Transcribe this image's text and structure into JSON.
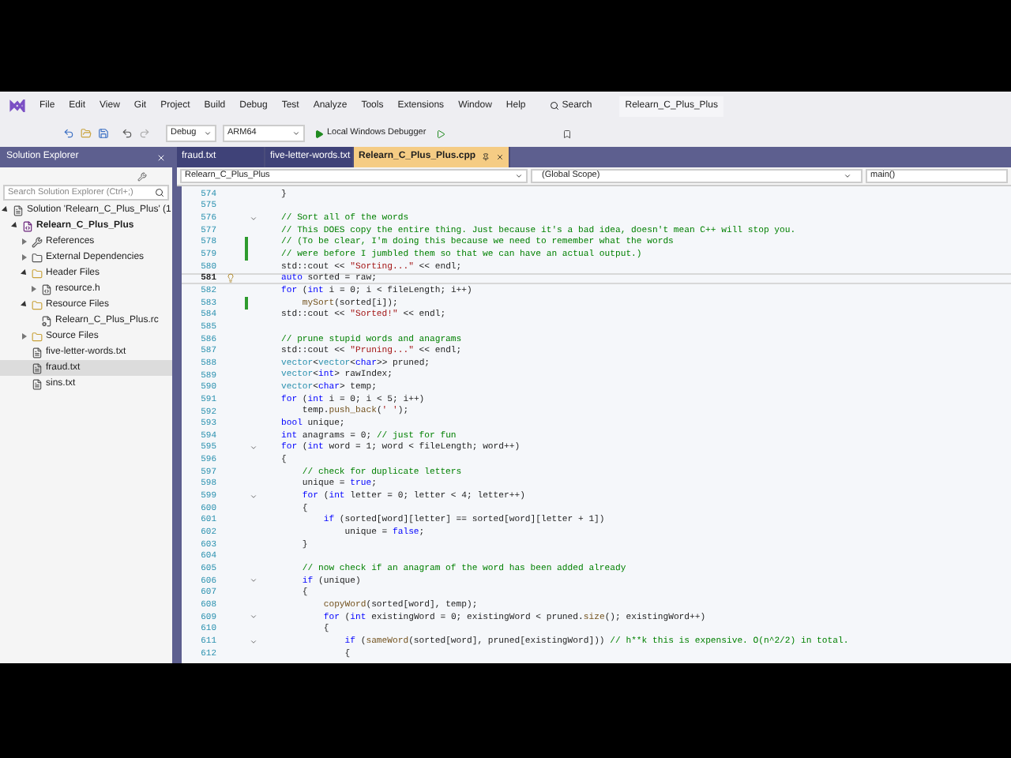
{
  "menu_bar": {
    "items": [
      "File",
      "Edit",
      "View",
      "Git",
      "Project",
      "Build",
      "Debug",
      "Test",
      "Analyze",
      "Tools",
      "Extensions",
      "Window",
      "Help"
    ],
    "search": "Search",
    "solution_title": "Relearn_C_Plus_Plus"
  },
  "toolbar": {
    "configuration": "Debug",
    "platform": "ARM64",
    "debugger": "Local Windows Debugger"
  },
  "solution_explorer": {
    "title": "Solution Explorer",
    "search_placeholder": "Search Solution Explorer (Ctrl+;)",
    "tree": [
      {
        "label": "Solution 'Relearn_C_Plus_Plus' (1",
        "kind": "solution",
        "expanded": true,
        "selected": false,
        "children": [
          {
            "label": "Relearn_C_Plus_Plus",
            "kind": "project",
            "expanded": true,
            "selected": false,
            "children": [
              {
                "label": "References",
                "kind": "references",
                "expanded": false,
                "selected": false
              },
              {
                "label": "External Dependencies",
                "kind": "dependencies",
                "expanded": false,
                "selected": false
              },
              {
                "label": "Header Files",
                "kind": "folder",
                "expanded": true,
                "selected": false,
                "children": [
                  {
                    "label": "resource.h",
                    "kind": "header",
                    "expanded": false,
                    "selected": false
                  }
                ]
              },
              {
                "label": "Resource Files",
                "kind": "folder",
                "expanded": true,
                "selected": false,
                "children": [
                  {
                    "label": "Relearn_C_Plus_Plus.rc",
                    "kind": "resource",
                    "selected": false
                  }
                ]
              },
              {
                "label": "Source Files",
                "kind": "folder",
                "expanded": false,
                "selected": false
              },
              {
                "label": "five-letter-words.txt",
                "kind": "file",
                "selected": false
              },
              {
                "label": "fraud.txt",
                "kind": "file",
                "selected": true
              },
              {
                "label": "sins.txt",
                "kind": "file",
                "selected": false
              }
            ]
          }
        ]
      }
    ]
  },
  "tabs": [
    {
      "label": "fraud.txt",
      "selected": false
    },
    {
      "label": "five-letter-words.txt",
      "selected": false
    },
    {
      "label": "Relearn_C_Plus_Plus.cpp",
      "selected": true
    }
  ],
  "navigation_bar": {
    "project": "Relearn_C_Plus_Plus",
    "scope": "(Global Scope)",
    "member": "main()"
  },
  "editor": {
    "lines": [
      {
        "n": "574",
        "changed": false,
        "lightbulb": false,
        "fold": false,
        "current": false,
        "segs": [
          {
            "kind": "plain",
            "text": "}"
          }
        ]
      },
      {
        "n": "575",
        "changed": false,
        "lightbulb": false,
        "fold": false,
        "current": false
      },
      {
        "n": "576",
        "changed": false,
        "lightbulb": false,
        "fold": true,
        "current": false,
        "segs": [
          {
            "kind": "comment",
            "text": "// Sort all of the words"
          }
        ]
      },
      {
        "n": "577",
        "changed": false,
        "lightbulb": false,
        "fold": false,
        "current": false,
        "segs": [
          {
            "kind": "comment",
            "text": "// This DOES copy the entire thing. Just because it's a bad idea, doesn't mean C++ will stop you."
          }
        ]
      },
      {
        "n": "578",
        "changed": true,
        "lightbulb": false,
        "fold": false,
        "current": false,
        "segs": [
          {
            "kind": "comment",
            "text": "// (To be clear, I'm doing this because we need to remember what the words"
          }
        ]
      },
      {
        "n": "579",
        "changed": true,
        "lightbulb": false,
        "fold": false,
        "current": false,
        "segs": [
          {
            "kind": "comment",
            "text": "// were before I jumbled them so that we can have an actual output.)"
          }
        ]
      },
      {
        "n": "580",
        "changed": false,
        "lightbulb": false,
        "fold": false,
        "current": false,
        "segs": [
          {
            "kind": "plain",
            "text": "std::cout << "
          },
          {
            "kind": "string",
            "text": "\"Sorting...\""
          },
          {
            "kind": "plain",
            "text": " << endl;"
          }
        ]
      },
      {
        "n": "581",
        "changed": false,
        "lightbulb": true,
        "fold": false,
        "current": true,
        "segs": [
          {
            "kind": "keyword",
            "text": "auto"
          },
          {
            "kind": "plain",
            "text": " sorted = raw;"
          }
        ]
      },
      {
        "n": "582",
        "changed": false,
        "lightbulb": false,
        "fold": false,
        "current": false,
        "segs": [
          {
            "kind": "keyword",
            "text": "for"
          },
          {
            "kind": "plain",
            "text": " ("
          },
          {
            "kind": "keyword",
            "text": "int"
          },
          {
            "kind": "plain",
            "text": " i = 0; i < fileLength; i++)"
          }
        ]
      },
      {
        "n": "583",
        "changed": true,
        "lightbulb": false,
        "fold": false,
        "current": false,
        "segs": [
          {
            "kind": "function",
            "text": "    mySort"
          },
          {
            "kind": "plain",
            "text": "(sorted[i]);"
          }
        ]
      },
      {
        "n": "584",
        "changed": false,
        "lightbulb": false,
        "fold": false,
        "current": false,
        "segs": [
          {
            "kind": "plain",
            "text": "std::cout << "
          },
          {
            "kind": "string",
            "text": "\"Sorted!\""
          },
          {
            "kind": "plain",
            "text": " << endl;"
          }
        ]
      },
      {
        "n": "585",
        "changed": false,
        "lightbulb": false,
        "fold": false,
        "current": false
      },
      {
        "n": "586",
        "changed": false,
        "lightbulb": false,
        "fold": false,
        "current": false,
        "segs": [
          {
            "kind": "comment",
            "text": "// prune stupid words and anagrams"
          }
        ]
      },
      {
        "n": "587",
        "changed": false,
        "lightbulb": false,
        "fold": false,
        "current": false,
        "segs": [
          {
            "kind": "plain",
            "text": "std::cout << "
          },
          {
            "kind": "string",
            "text": "\"Pruning...\""
          },
          {
            "kind": "plain",
            "text": " << endl;"
          }
        ]
      },
      {
        "n": "588",
        "changed": false,
        "lightbulb": false,
        "fold": false,
        "current": false,
        "segs": [
          {
            "kind": "type",
            "text": "vector"
          },
          {
            "kind": "plain",
            "text": "<"
          },
          {
            "kind": "type",
            "text": "vector"
          },
          {
            "kind": "plain",
            "text": "<"
          },
          {
            "kind": "keyword",
            "text": "char"
          },
          {
            "kind": "plain",
            "text": ">> pruned;"
          }
        ]
      },
      {
        "n": "589",
        "changed": false,
        "lightbulb": false,
        "fold": false,
        "current": false,
        "segs": [
          {
            "kind": "type",
            "text": "vector"
          },
          {
            "kind": "plain",
            "text": "<"
          },
          {
            "kind": "keyword",
            "text": "int"
          },
          {
            "kind": "plain",
            "text": "> rawIndex;"
          }
        ]
      },
      {
        "n": "590",
        "changed": false,
        "lightbulb": false,
        "fold": false,
        "current": false,
        "segs": [
          {
            "kind": "type",
            "text": "vector"
          },
          {
            "kind": "plain",
            "text": "<"
          },
          {
            "kind": "keyword",
            "text": "char"
          },
          {
            "kind": "plain",
            "text": "> temp;"
          }
        ]
      },
      {
        "n": "591",
        "changed": false,
        "lightbulb": false,
        "fold": false,
        "current": false,
        "segs": [
          {
            "kind": "keyword",
            "text": "for"
          },
          {
            "kind": "plain",
            "text": " ("
          },
          {
            "kind": "keyword",
            "text": "int"
          },
          {
            "kind": "plain",
            "text": " i = 0; i < 5; i++)"
          }
        ]
      },
      {
        "n": "592",
        "changed": false,
        "lightbulb": false,
        "fold": false,
        "current": false,
        "segs": [
          {
            "kind": "plain",
            "text": "    temp."
          },
          {
            "kind": "function",
            "text": "push_back"
          },
          {
            "kind": "plain",
            "text": "("
          },
          {
            "kind": "string",
            "text": "' '"
          },
          {
            "kind": "plain",
            "text": ");"
          }
        ]
      },
      {
        "n": "593",
        "changed": false,
        "lightbulb": false,
        "fold": false,
        "current": false,
        "segs": [
          {
            "kind": "keyword",
            "text": "bool"
          },
          {
            "kind": "plain",
            "text": " unique;"
          }
        ]
      },
      {
        "n": "594",
        "changed": false,
        "lightbulb": false,
        "fold": false,
        "current": false,
        "segs": [
          {
            "kind": "keyword",
            "text": "int"
          },
          {
            "kind": "plain",
            "text": " anagrams = 0; "
          },
          {
            "kind": "comment",
            "text": "// just for fun"
          }
        ]
      },
      {
        "n": "595",
        "changed": false,
        "lightbulb": false,
        "fold": true,
        "current": false,
        "segs": [
          {
            "kind": "keyword",
            "text": "for"
          },
          {
            "kind": "plain",
            "text": " ("
          },
          {
            "kind": "keyword",
            "text": "int"
          },
          {
            "kind": "plain",
            "text": " word = 1; word < fileLength; word++)"
          }
        ]
      },
      {
        "n": "596",
        "changed": false,
        "lightbulb": false,
        "fold": false,
        "current": false,
        "segs": [
          {
            "kind": "plain",
            "text": "{"
          }
        ]
      },
      {
        "n": "597",
        "changed": false,
        "lightbulb": false,
        "fold": false,
        "current": false,
        "segs": [
          {
            "kind": "comment",
            "text": "    // check for duplicate letters"
          }
        ]
      },
      {
        "n": "598",
        "changed": false,
        "lightbulb": false,
        "fold": false,
        "current": false,
        "segs": [
          {
            "kind": "plain",
            "text": "    unique = "
          },
          {
            "kind": "keyword",
            "text": "true"
          },
          {
            "kind": "plain",
            "text": ";"
          }
        ]
      },
      {
        "n": "599",
        "changed": false,
        "lightbulb": false,
        "fold": true,
        "current": false,
        "segs": [
          {
            "kind": "keyword",
            "text": "    for"
          },
          {
            "kind": "plain",
            "text": " ("
          },
          {
            "kind": "keyword",
            "text": "int"
          },
          {
            "kind": "plain",
            "text": " letter = 0; letter < 4; letter++)"
          }
        ]
      },
      {
        "n": "600",
        "changed": false,
        "lightbulb": false,
        "fold": false,
        "current": false,
        "segs": [
          {
            "kind": "plain",
            "text": "    {"
          }
        ]
      },
      {
        "n": "601",
        "changed": false,
        "lightbulb": false,
        "fold": false,
        "current": false,
        "segs": [
          {
            "kind": "keyword",
            "text": "        if"
          },
          {
            "kind": "plain",
            "text": " (sorted[word][letter] == sorted[word][letter + 1])"
          }
        ]
      },
      {
        "n": "602",
        "changed": false,
        "lightbulb": false,
        "fold": false,
        "current": false,
        "segs": [
          {
            "kind": "plain",
            "text": "            unique = "
          },
          {
            "kind": "keyword",
            "text": "false"
          },
          {
            "kind": "plain",
            "text": ";"
          }
        ]
      },
      {
        "n": "603",
        "changed": false,
        "lightbulb": false,
        "fold": false,
        "current": false,
        "segs": [
          {
            "kind": "plain",
            "text": "    }"
          }
        ]
      },
      {
        "n": "604",
        "changed": false,
        "lightbulb": false,
        "fold": false,
        "current": false
      },
      {
        "n": "605",
        "changed": false,
        "lightbulb": false,
        "fold": false,
        "current": false,
        "segs": [
          {
            "kind": "comment",
            "text": "    // now check if an anagram of the word has been added already"
          }
        ]
      },
      {
        "n": "606",
        "changed": false,
        "lightbulb": false,
        "fold": true,
        "current": false,
        "segs": [
          {
            "kind": "keyword",
            "text": "    if"
          },
          {
            "kind": "plain",
            "text": " (unique)"
          }
        ]
      },
      {
        "n": "607",
        "changed": false,
        "lightbulb": false,
        "fold": false,
        "current": false,
        "segs": [
          {
            "kind": "plain",
            "text": "    {"
          }
        ]
      },
      {
        "n": "608",
        "changed": false,
        "lightbulb": false,
        "fold": false,
        "current": false,
        "segs": [
          {
            "kind": "function",
            "text": "        copyWord"
          },
          {
            "kind": "plain",
            "text": "(sorted[word], temp);"
          }
        ]
      },
      {
        "n": "609",
        "changed": false,
        "lightbulb": false,
        "fold": true,
        "current": false,
        "segs": [
          {
            "kind": "keyword",
            "text": "        for"
          },
          {
            "kind": "plain",
            "text": " ("
          },
          {
            "kind": "keyword",
            "text": "int"
          },
          {
            "kind": "plain",
            "text": " existingWord = 0; existingWord < pruned."
          },
          {
            "kind": "function",
            "text": "size"
          },
          {
            "kind": "plain",
            "text": "(); existingWord++)"
          }
        ]
      },
      {
        "n": "610",
        "changed": false,
        "lightbulb": false,
        "fold": false,
        "current": false,
        "segs": [
          {
            "kind": "plain",
            "text": "        {"
          }
        ]
      },
      {
        "n": "611",
        "changed": false,
        "lightbulb": false,
        "fold": true,
        "current": false,
        "segs": [
          {
            "kind": "keyword",
            "text": "            if"
          },
          {
            "kind": "plain",
            "text": " ("
          },
          {
            "kind": "function",
            "text": "sameWord"
          },
          {
            "kind": "plain",
            "text": "(sorted[word], pruned[existingWord])) "
          },
          {
            "kind": "comment",
            "text": "// h**k this is expensive. O(n^2/2) in total."
          }
        ]
      },
      {
        "n": "612",
        "changed": false,
        "lightbulb": false,
        "fold": false,
        "current": false,
        "segs": [
          {
            "kind": "plain",
            "text": "            {"
          }
        ]
      }
    ]
  }
}
